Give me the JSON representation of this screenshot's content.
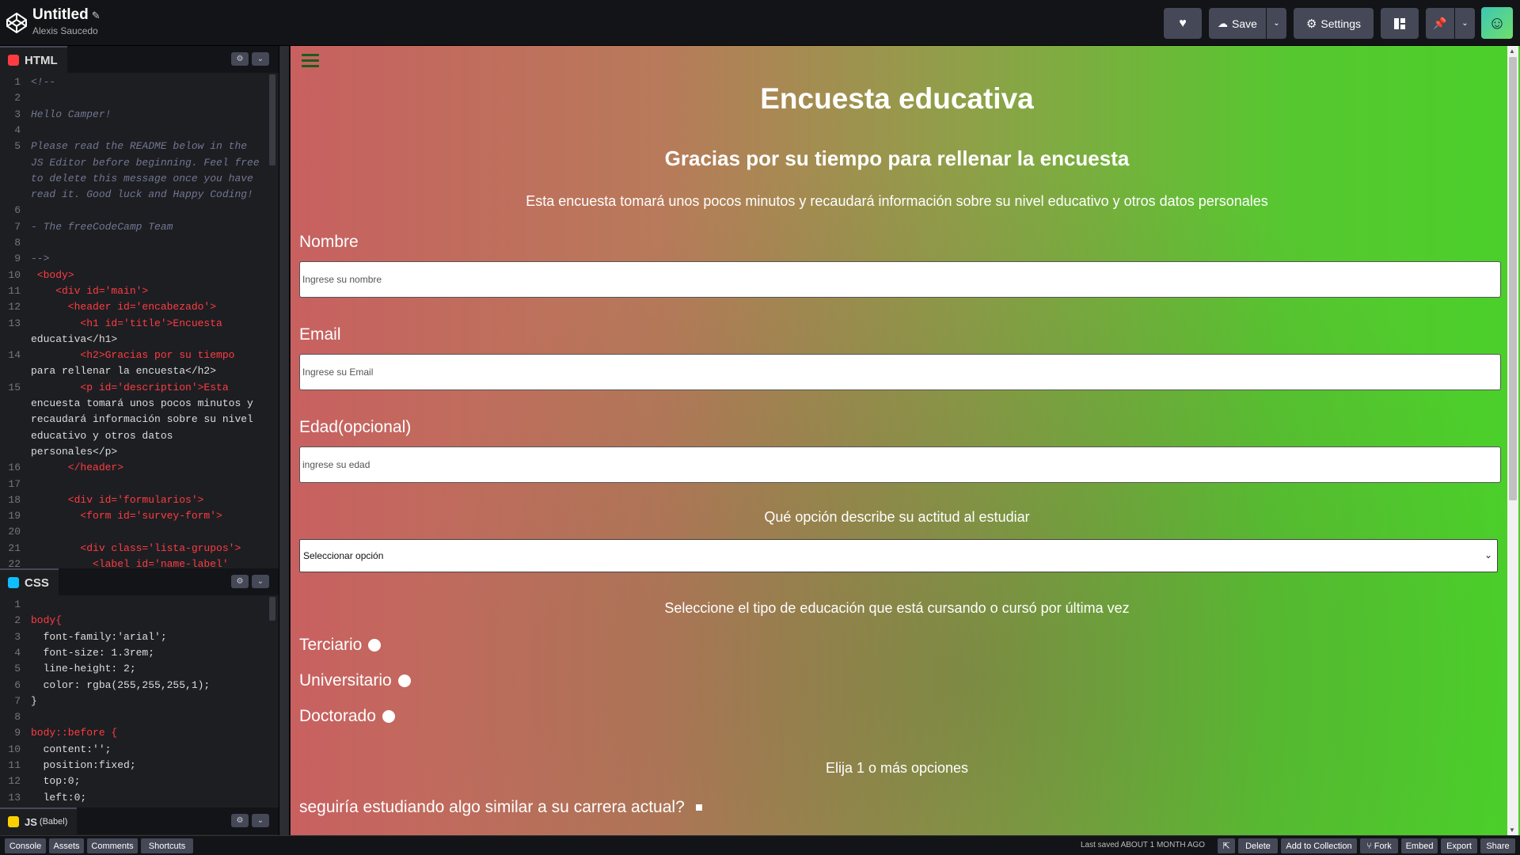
{
  "window": {
    "title": "Untitled",
    "author": "Alexis Saucedo"
  },
  "toolbar": {
    "save_label": "Save",
    "settings_label": "Settings"
  },
  "html_panel": {
    "label": "HTML",
    "lines": [
      {
        "n": "1",
        "t": "<!--",
        "c": "com"
      },
      {
        "n": "2",
        "t": "",
        "c": "txt"
      },
      {
        "n": "3",
        "t": "Hello Camper!",
        "c": "com"
      },
      {
        "n": "4",
        "t": "",
        "c": "txt"
      },
      {
        "n": "5",
        "t": "Please read the README below in the",
        "c": "com"
      },
      {
        "n": "",
        "t": "JS Editor before beginning. Feel free",
        "c": "com"
      },
      {
        "n": "",
        "t": "to delete this message once you have",
        "c": "com"
      },
      {
        "n": "",
        "t": "read it. Good luck and Happy Coding!",
        "c": "com"
      },
      {
        "n": "6",
        "t": "",
        "c": "txt"
      },
      {
        "n": "7",
        "t": "- The freeCodeCamp Team",
        "c": "com"
      },
      {
        "n": "8",
        "t": "",
        "c": "txt"
      },
      {
        "n": "9",
        "t": "-->",
        "c": "com"
      },
      {
        "n": "10",
        "t": " <body>",
        "c": "tag"
      },
      {
        "n": "11",
        "t": "    <div id='main'>",
        "c": "tag"
      },
      {
        "n": "12",
        "t": "      <header id='encabezado'>",
        "c": "tag"
      },
      {
        "n": "13",
        "t": "        <h1 id='title'>Encuesta",
        "c": "tag"
      },
      {
        "n": "",
        "t": "educativa</h1>",
        "c": "txt"
      },
      {
        "n": "14",
        "t": "        <h2>Gracias por su tiempo",
        "c": "tag"
      },
      {
        "n": "",
        "t": "para rellenar la encuesta</h2>",
        "c": "txt"
      },
      {
        "n": "15",
        "t": "        <p id='description'>Esta",
        "c": "tag"
      },
      {
        "n": "",
        "t": "encuesta tomará unos pocos minutos y",
        "c": "txt"
      },
      {
        "n": "",
        "t": "recaudará información sobre su nivel",
        "c": "txt"
      },
      {
        "n": "",
        "t": "educativo y otros datos",
        "c": "txt"
      },
      {
        "n": "",
        "t": "personales</p>",
        "c": "txt"
      },
      {
        "n": "16",
        "t": "      </header>",
        "c": "tag"
      },
      {
        "n": "17",
        "t": "",
        "c": "txt"
      },
      {
        "n": "18",
        "t": "      <div id='formularios'>",
        "c": "tag"
      },
      {
        "n": "19",
        "t": "        <form id='survey-form'>",
        "c": "tag"
      },
      {
        "n": "20",
        "t": "",
        "c": "txt"
      },
      {
        "n": "21",
        "t": "        <div class='lista-grupos'>",
        "c": "tag"
      },
      {
        "n": "22",
        "t": "          <label id='name-label'",
        "c": "tag"
      }
    ]
  },
  "css_panel": {
    "label": "CSS",
    "lines": [
      {
        "n": "1",
        "t": "",
        "c": "txt"
      },
      {
        "n": "2",
        "t": "body{",
        "c": "sel"
      },
      {
        "n": "3",
        "t": "  font-family:'arial';",
        "c": "prop"
      },
      {
        "n": "4",
        "t": "  font-size: 1.3rem;",
        "c": "prop"
      },
      {
        "n": "5",
        "t": "  line-height: 2;",
        "c": "prop"
      },
      {
        "n": "6",
        "t": "  color: rgba(255,255,255,1);",
        "c": "prop"
      },
      {
        "n": "7",
        "t": "}",
        "c": "txt"
      },
      {
        "n": "8",
        "t": "",
        "c": "txt"
      },
      {
        "n": "9",
        "t": "body::before {",
        "c": "sel"
      },
      {
        "n": "10",
        "t": "  content:'';",
        "c": "prop"
      },
      {
        "n": "11",
        "t": "  position:fixed;",
        "c": "prop"
      },
      {
        "n": "12",
        "t": "  top:0;",
        "c": "prop"
      },
      {
        "n": "13",
        "t": "  left:0;",
        "c": "prop"
      }
    ]
  },
  "js_panel": {
    "label": "JS",
    "sublabel": "(Babel)"
  },
  "preview": {
    "h1": "Encuesta educativa",
    "h2": "Gracias por su tiempo para rellenar la encuesta",
    "description": "Esta encuesta tomará unos pocos minutos y recaudará información sobre su nivel educativo y otros datos personales",
    "name_label": "Nombre",
    "name_placeholder": "Ingrese su nombre",
    "email_label": "Email",
    "email_placeholder": "Ingrese su Email",
    "age_label": "Edad(opcional)",
    "age_placeholder": "ingrese su edad",
    "attitude_question": "Qué opción describe su actitud al estudiar",
    "select_value": "Seleccionar opción",
    "education_question": "Seleccione el tipo de educación que está cursando o cursó por última vez",
    "radio_options": [
      "Terciario",
      "Universitario",
      "Doctorado"
    ],
    "multi_prompt": "Elija 1 o más opciones",
    "checkbox_label": "seguiría estudiando algo similar a su carrera actual?"
  },
  "bottombar": {
    "console": "Console",
    "assets": "Assets",
    "comments": "Comments",
    "shortcuts": "Shortcuts",
    "last_saved": "Last saved ABOUT 1 MONTH AGO",
    "delete": "Delete",
    "add_to_collection": "Add to Collection",
    "fork": "Fork",
    "embed": "Embed",
    "export": "Export",
    "share": "Share"
  },
  "colors": {
    "comment": "#717790",
    "tag": "#ff3c41",
    "attr": "#a88038",
    "string": "#ffdd40",
    "selector": "#ff3c41",
    "number": "#ff3c41",
    "accent_html": "#ff3c41",
    "accent_css": "#0ebeff",
    "accent_js": "#fcd000"
  }
}
